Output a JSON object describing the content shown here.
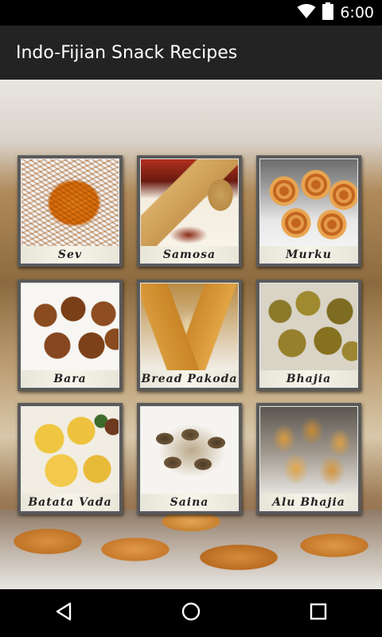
{
  "status_bar": {
    "time": "6:00",
    "icons": [
      "wifi-icon",
      "battery-icon"
    ]
  },
  "app_bar": {
    "title": "Indo-Fijian Snack Recipes"
  },
  "recipes": [
    {
      "label": "Sev",
      "photo": "sev"
    },
    {
      "label": "Samosa",
      "photo": "samosa"
    },
    {
      "label": "Murku",
      "photo": "murku"
    },
    {
      "label": "Bara",
      "photo": "bara"
    },
    {
      "label": "Bread Pakoda",
      "photo": "bread-pakoda"
    },
    {
      "label": "Bhajia",
      "photo": "bhajia"
    },
    {
      "label": "Batata Vada",
      "photo": "batata-vada"
    },
    {
      "label": "Saina",
      "photo": "saina"
    },
    {
      "label": "Alu Bhajia",
      "photo": "alu-bhajia"
    }
  ],
  "nav_bar": {
    "icons": [
      "back-icon",
      "home-icon",
      "recents-icon"
    ]
  },
  "colors": {
    "status_bar": "#000000",
    "app_bar": "#232323",
    "tile_frame": "#5a5a5a",
    "label_text": "#222222"
  }
}
